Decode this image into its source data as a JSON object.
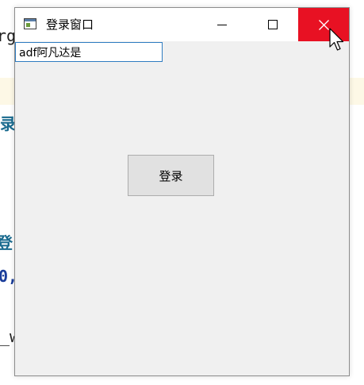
{
  "background": {
    "fragments": [
      "rg",
      "录",
      "登",
      "0,",
      "_w"
    ]
  },
  "window": {
    "title": "登录窗口",
    "icon": "window-app-icon",
    "controls": {
      "minimize_icon": "minimize-icon",
      "maximize_icon": "maximize-icon",
      "close_icon": "close-icon",
      "close_hover_color": "#e81123"
    }
  },
  "form": {
    "input_value": "adf阿凡达是",
    "login_label": "登录"
  },
  "colors": {
    "window_bg": "#f0f0f0",
    "input_border_focus": "#2f7cc1",
    "button_bg": "#e1e1e1"
  }
}
